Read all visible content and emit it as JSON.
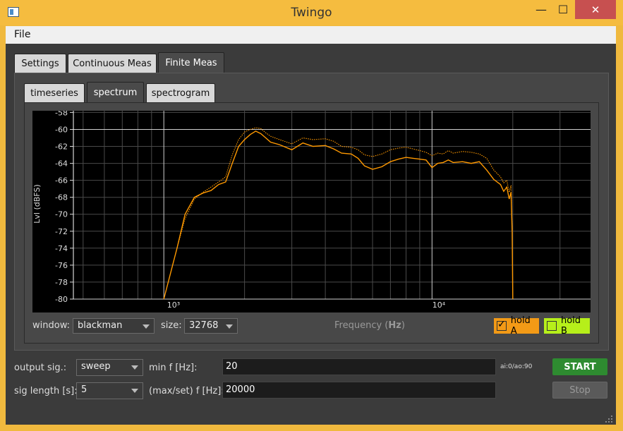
{
  "window": {
    "title": "Twingo",
    "minimize_glyph": "—",
    "maximize_glyph": "☐",
    "close_glyph": "✕"
  },
  "menu": {
    "file": "File"
  },
  "tabs_main": [
    "Settings",
    "Continuous Meas",
    "Finite Meas"
  ],
  "tabs_sub": [
    "timeseries",
    "spectrum",
    "spectrogram"
  ],
  "plot": {
    "ylabel": "Lvl (dBFS)",
    "xlabel_pre": "Frequency (",
    "xlabel_unit": "Hz",
    "xlabel_post": ")",
    "y_ticks": [
      "-58",
      "-60",
      "-62",
      "-64",
      "-66",
      "-68",
      "-70",
      "-72",
      "-74",
      "-76",
      "-78",
      "-80"
    ],
    "x_tick_1k": "10³",
    "x_tick_10k": "10⁴"
  },
  "controls": {
    "window_label": "window:",
    "window_value": "blackman",
    "size_label": "size:",
    "size_value": "32768",
    "hold_a": "hold A",
    "hold_a_check": "✓",
    "hold_b": "hold B"
  },
  "bottom": {
    "output_sig_label": "output sig.:",
    "output_sig_value": "sweep",
    "min_f_label": "min f [Hz]:",
    "min_f_value": "20",
    "io_status": "ai:0/ao:90",
    "start": "START",
    "sig_length_label": "sig length [s]:",
    "sig_length_value": "5",
    "max_f_label": "(max/set) f [Hz]:",
    "max_f_value": "20000",
    "stop": "Stop"
  },
  "colors": {
    "accent_orange": "#ff9900",
    "hold_a_bg": "#f39a16",
    "hold_b_bg": "#b6ef1a",
    "start_green": "#2e8b30"
  },
  "chart_data": {
    "type": "line",
    "x_scale": "log",
    "xlim": [
      460,
      39000
    ],
    "ylim": [
      -80,
      -57.8
    ],
    "ylabel": "Lvl (dBFS)",
    "xlabel": "Frequency (Hz)",
    "series": [
      {
        "name": "hold A",
        "color": "#ff9900",
        "x": [
          1000,
          1120,
          1200,
          1300,
          1400,
          1500,
          1600,
          1700,
          1800,
          1900,
          2000,
          2100,
          2200,
          2300,
          2400,
          2500,
          2700,
          3000,
          3300,
          3600,
          4000,
          4300,
          4600,
          5000,
          5300,
          5600,
          6000,
          6500,
          7000,
          7500,
          8000,
          8500,
          9000,
          9500,
          10000,
          10500,
          11000,
          11500,
          12000,
          13000,
          14000,
          15000,
          16000,
          17000,
          18000,
          18500,
          19000,
          19400,
          19700,
          19900,
          20000
        ],
        "y": [
          -80,
          -74,
          -70,
          -68,
          -67.5,
          -67.2,
          -66.5,
          -66.2,
          -64,
          -62,
          -61.2,
          -60.6,
          -60.2,
          -60.5,
          -61,
          -61.5,
          -61.8,
          -62.4,
          -61.6,
          -62,
          -61.9,
          -62.3,
          -62.8,
          -62.9,
          -63.4,
          -64.3,
          -64.7,
          -64.4,
          -63.8,
          -63.5,
          -63.3,
          -63.4,
          -63.5,
          -63.6,
          -64.5,
          -64.0,
          -63.9,
          -63.6,
          -63.9,
          -63.8,
          -64.0,
          -63.8,
          -64.8,
          -65.9,
          -66.5,
          -67.3,
          -66.8,
          -68.2,
          -67.4,
          -72,
          -80
        ]
      },
      {
        "name": "hold B",
        "color": "#ff9900",
        "x": [
          1120,
          1200,
          1300,
          1400,
          1500,
          1600,
          1700,
          1800,
          1900,
          2000,
          2100,
          2200,
          2300,
          2400,
          2500,
          2700,
          3000,
          3300,
          3600,
          4000,
          4300,
          4600,
          5000,
          5300,
          5600,
          6000,
          6500,
          7000,
          7500,
          8000,
          8500,
          9000,
          9500,
          10000,
          10500,
          11000,
          11500,
          12000,
          13000,
          14000,
          15000,
          16000,
          17000,
          18000,
          18500,
          19000,
          19400,
          19700,
          19900
        ],
        "y": [
          -74,
          -70.5,
          -68.2,
          -67.4,
          -66.8,
          -66.2,
          -65.6,
          -63,
          -61.2,
          -60.3,
          -60,
          -59.8,
          -59.9,
          -60.4,
          -60.8,
          -61.2,
          -61.7,
          -61,
          -61.2,
          -61.1,
          -61.4,
          -62,
          -62.1,
          -62.4,
          -63,
          -63.2,
          -62.9,
          -62.4,
          -62.2,
          -62.1,
          -62.3,
          -62.5,
          -62.7,
          -63.1,
          -62.8,
          -62.9,
          -62.5,
          -62.8,
          -62.6,
          -62.7,
          -62.9,
          -63.4,
          -64.8,
          -65.6,
          -66.3,
          -66,
          -67.4,
          -66.6,
          -72
        ]
      }
    ]
  }
}
